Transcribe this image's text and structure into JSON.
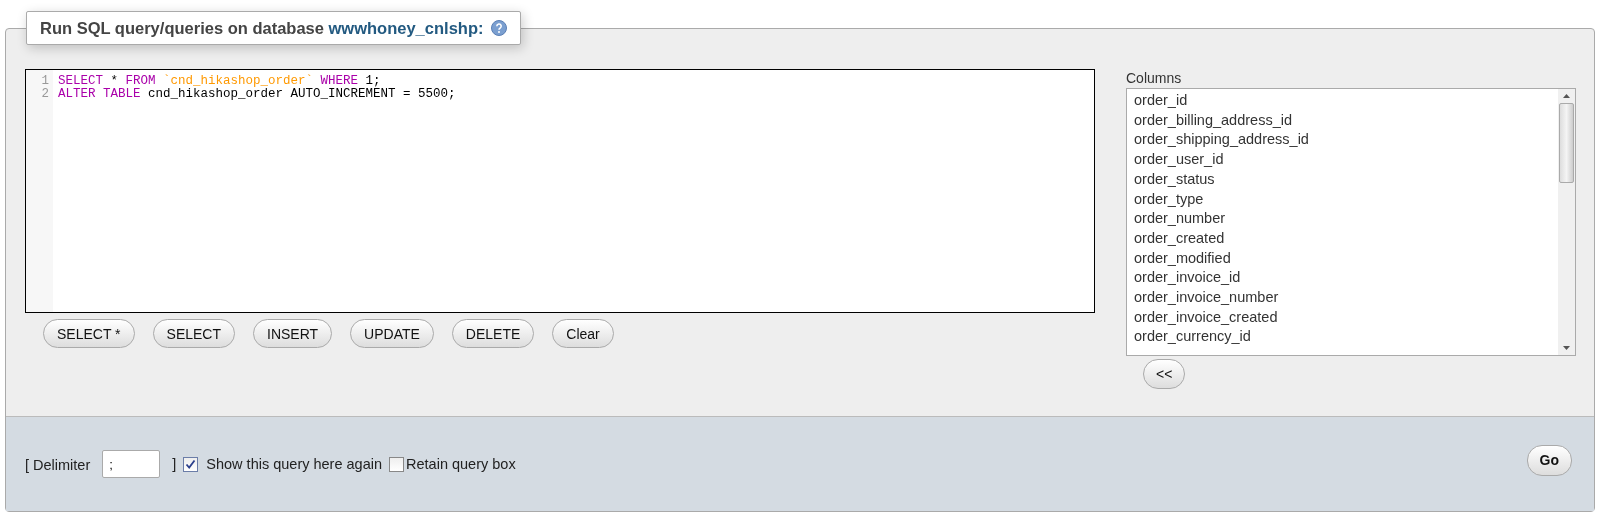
{
  "legend": {
    "text": "Run SQL query/queries on database",
    "database": "wwwhoney_cnlshp:"
  },
  "editor": {
    "lines": [
      {
        "number": "1",
        "tokens": [
          {
            "kind": "keyword",
            "text": "SELECT"
          },
          {
            "kind": "plain",
            "text": "*"
          },
          {
            "kind": "keyword",
            "text": "FROM"
          },
          {
            "kind": "string",
            "text": "`cnd_hikashop_order`"
          },
          {
            "kind": "keyword",
            "text": "WHERE"
          },
          {
            "kind": "plain",
            "text": "1;"
          }
        ]
      },
      {
        "number": "2",
        "tokens": [
          {
            "kind": "keyword",
            "text": "ALTER TABLE"
          },
          {
            "kind": "plain",
            "text": "cnd_hikashop_order AUTO_INCREMENT = 5500;"
          }
        ]
      }
    ]
  },
  "query_buttons": [
    "SELECT *",
    "SELECT",
    "INSERT",
    "UPDATE",
    "DELETE",
    "Clear"
  ],
  "columns": {
    "label": "Columns",
    "items": [
      "order_id",
      "order_billing_address_id",
      "order_shipping_address_id",
      "order_user_id",
      "order_status",
      "order_type",
      "order_number",
      "order_created",
      "order_modified",
      "order_invoice_id",
      "order_invoice_number",
      "order_invoice_created",
      "order_currency_id"
    ],
    "insert_button": "<<"
  },
  "footer": {
    "delimiter_open": "[ Delimiter",
    "delimiter_value": ";",
    "delimiter_close": "]",
    "options": [
      {
        "label": "Show this query here again",
        "checked": true
      },
      {
        "label": "Retain query box",
        "checked": false
      }
    ],
    "go_button": "Go"
  }
}
